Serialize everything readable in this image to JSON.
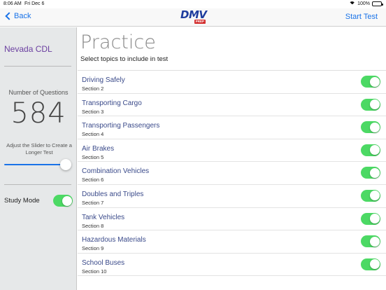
{
  "status_bar": {
    "time": "8:06 AM",
    "date": "Fri Dec 6",
    "battery": "100%"
  },
  "nav": {
    "back_label": "Back",
    "logo_text": "DMV",
    "logo_badge": "PREP",
    "start_label": "Start Test"
  },
  "sidebar": {
    "title": "Nevada CDL",
    "questions_label": "Number of Questions",
    "questions_value": "584",
    "slider_hint": "Adjust the Slider to Create a Longer Test",
    "slider_level": 1.0,
    "study_mode_label": "Study Mode",
    "study_mode_on": true
  },
  "main": {
    "title": "Practice",
    "subtitle": "Select topics to include in test",
    "topics": [
      {
        "name": "Driving Safely",
        "section": "Section 2",
        "enabled": true
      },
      {
        "name": "Transporting Cargo",
        "section": "Section 3",
        "enabled": true
      },
      {
        "name": "Transporting Passengers",
        "section": "Section 4",
        "enabled": true
      },
      {
        "name": "Air Brakes",
        "section": "Section 5",
        "enabled": true
      },
      {
        "name": "Combination Vehicles",
        "section": "Section 6",
        "enabled": true
      },
      {
        "name": "Doubles and Triples",
        "section": "Section 7",
        "enabled": true
      },
      {
        "name": "Tank Vehicles",
        "section": "Section 8",
        "enabled": true
      },
      {
        "name": "Hazardous Materials",
        "section": "Section 9",
        "enabled": true
      },
      {
        "name": "School Buses",
        "section": "Section 10",
        "enabled": true
      }
    ]
  },
  "colors": {
    "accent": "#1a73e8",
    "toggle_on": "#4cd964",
    "sidebar_title": "#6b3fa0",
    "topic_name": "#3a4a8a"
  },
  "icons": {
    "back": "chevron-left-icon",
    "wifi": "wifi-icon",
    "battery": "battery-icon"
  }
}
